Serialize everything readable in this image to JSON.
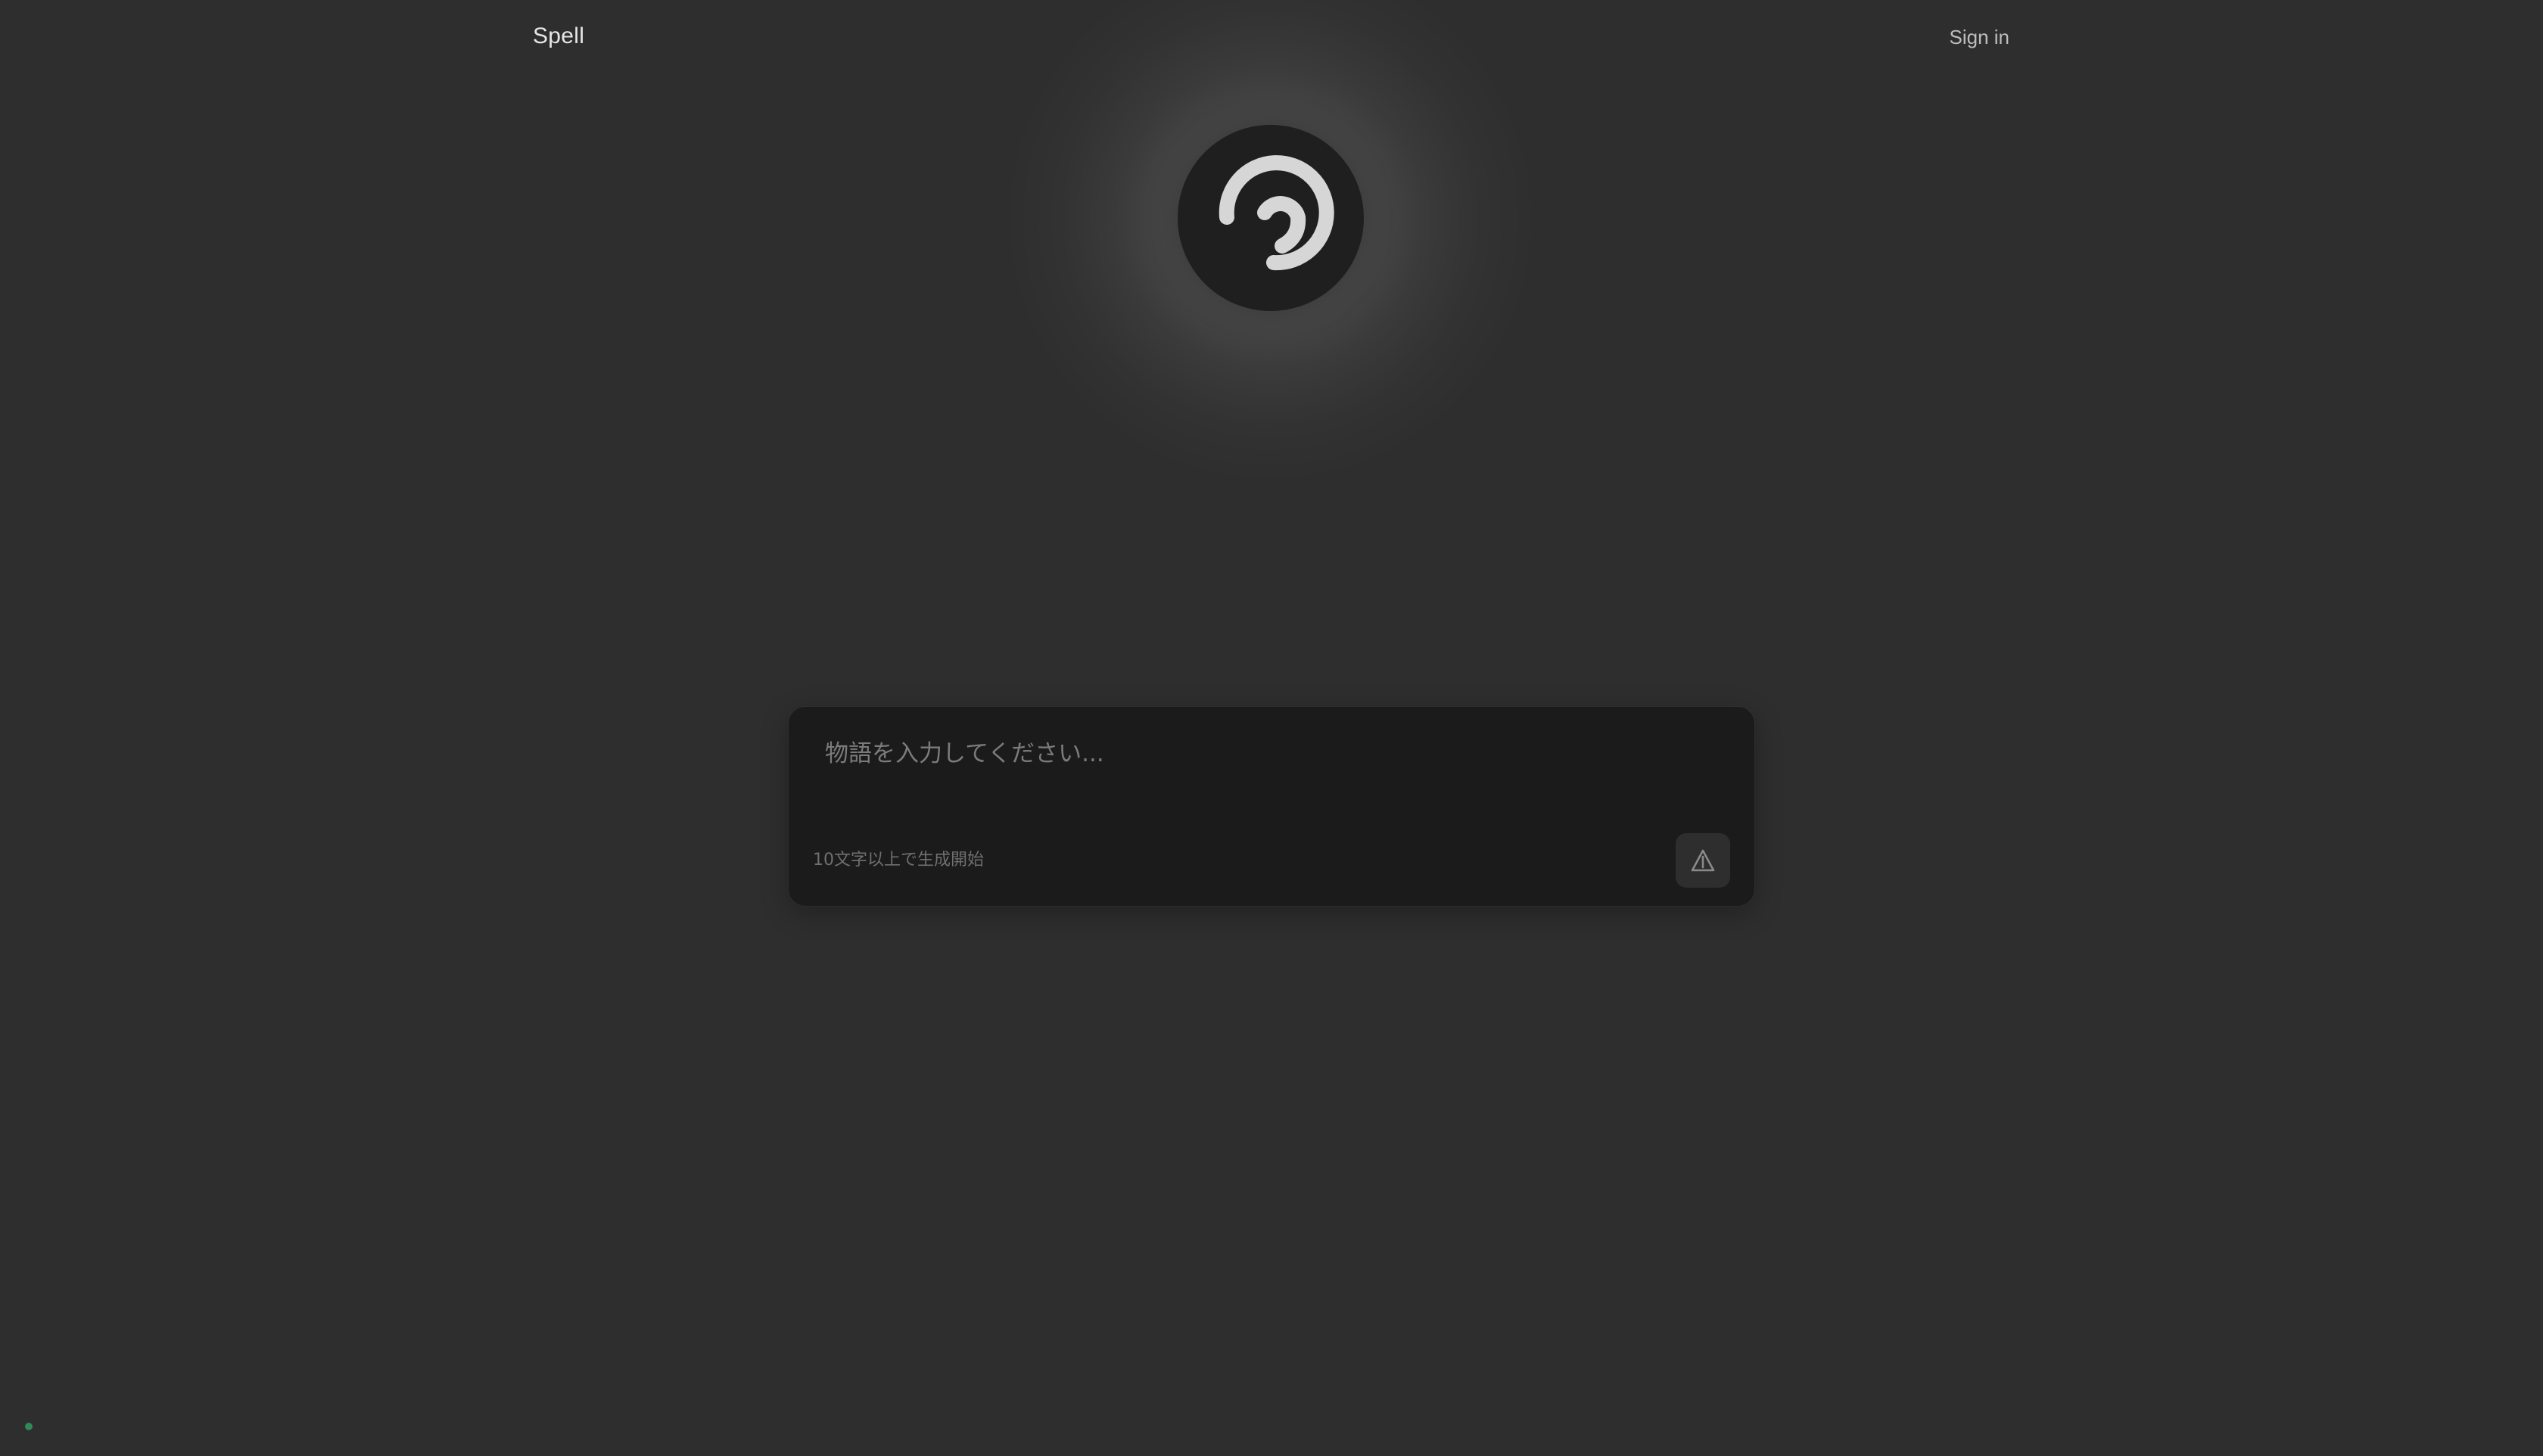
{
  "header": {
    "brand": "Spell",
    "sign_in": "Sign in"
  },
  "logo": {
    "icon": "spell-swirl-logo-icon"
  },
  "composer": {
    "placeholder": "物語を入力してください...",
    "value": "",
    "hint": "10文字以上で生成開始",
    "send_icon": "send-triangle-icon"
  },
  "status": {
    "indicator_color": "#2f8a58"
  },
  "colors": {
    "background": "#2e2e2e",
    "card": "#1b1b1b",
    "logo_bg": "#1f1f1f"
  }
}
